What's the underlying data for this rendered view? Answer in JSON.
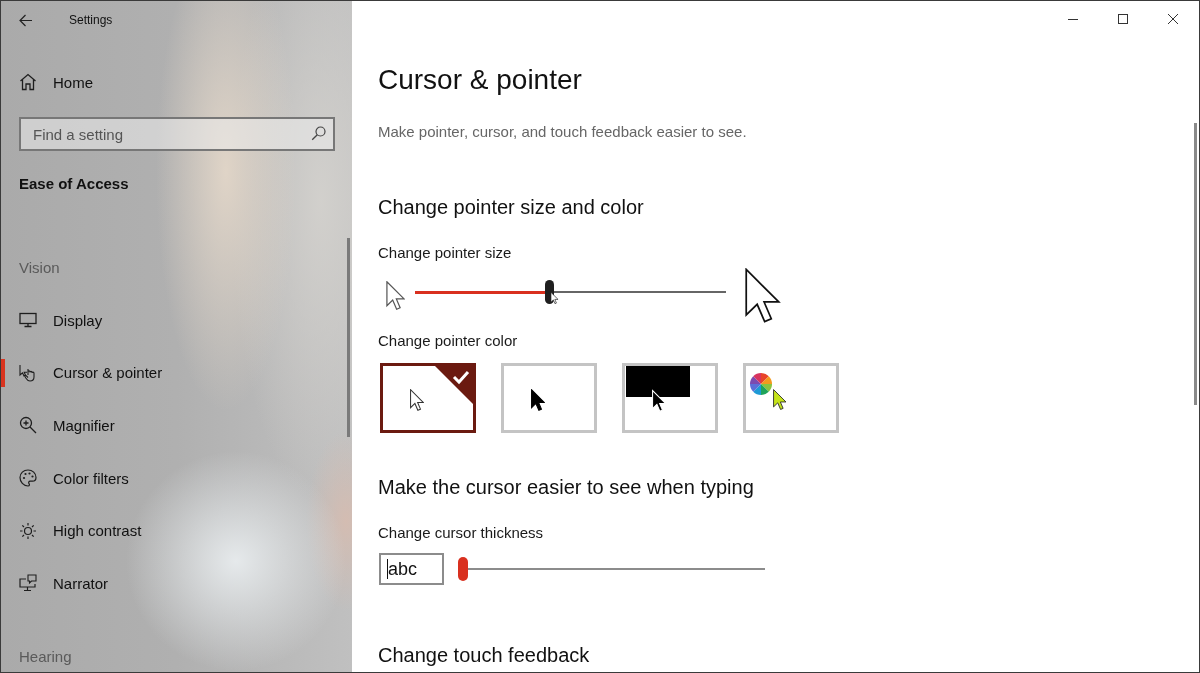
{
  "window": {
    "title": "Settings"
  },
  "sidebar": {
    "home": "Home",
    "search": {
      "placeholder": "Find a setting"
    },
    "section": "Ease of Access",
    "groups": [
      {
        "heading": "Vision",
        "items": [
          {
            "label": "Display",
            "selected": false
          },
          {
            "label": "Cursor & pointer",
            "selected": true
          },
          {
            "label": "Magnifier",
            "selected": false
          },
          {
            "label": "Color filters",
            "selected": false
          },
          {
            "label": "High contrast",
            "selected": false
          },
          {
            "label": "Narrator",
            "selected": false
          }
        ]
      },
      {
        "heading": "Hearing"
      }
    ]
  },
  "page": {
    "title": "Cursor & pointer",
    "description": "Make pointer, cursor, and touch feedback easier to see.",
    "sections": [
      {
        "heading": "Change pointer size and color",
        "controls": [
          {
            "kind": "size_slider",
            "label": "Change pointer size",
            "level": 0.43
          },
          {
            "kind": "color_options",
            "label": "Change pointer color",
            "options": [
              {
                "kind": "white",
                "selected": true
              },
              {
                "kind": "black",
                "selected": false
              },
              {
                "kind": "inverted",
                "selected": false
              },
              {
                "kind": "custom",
                "selected": false
              }
            ]
          }
        ]
      },
      {
        "heading": "Make the cursor easier to see when typing",
        "controls": [
          {
            "kind": "thickness_slider",
            "label": "Change cursor thickness",
            "preview": "abc",
            "level": 0
          }
        ]
      },
      {
        "heading": "Change touch feedback"
      }
    ]
  }
}
